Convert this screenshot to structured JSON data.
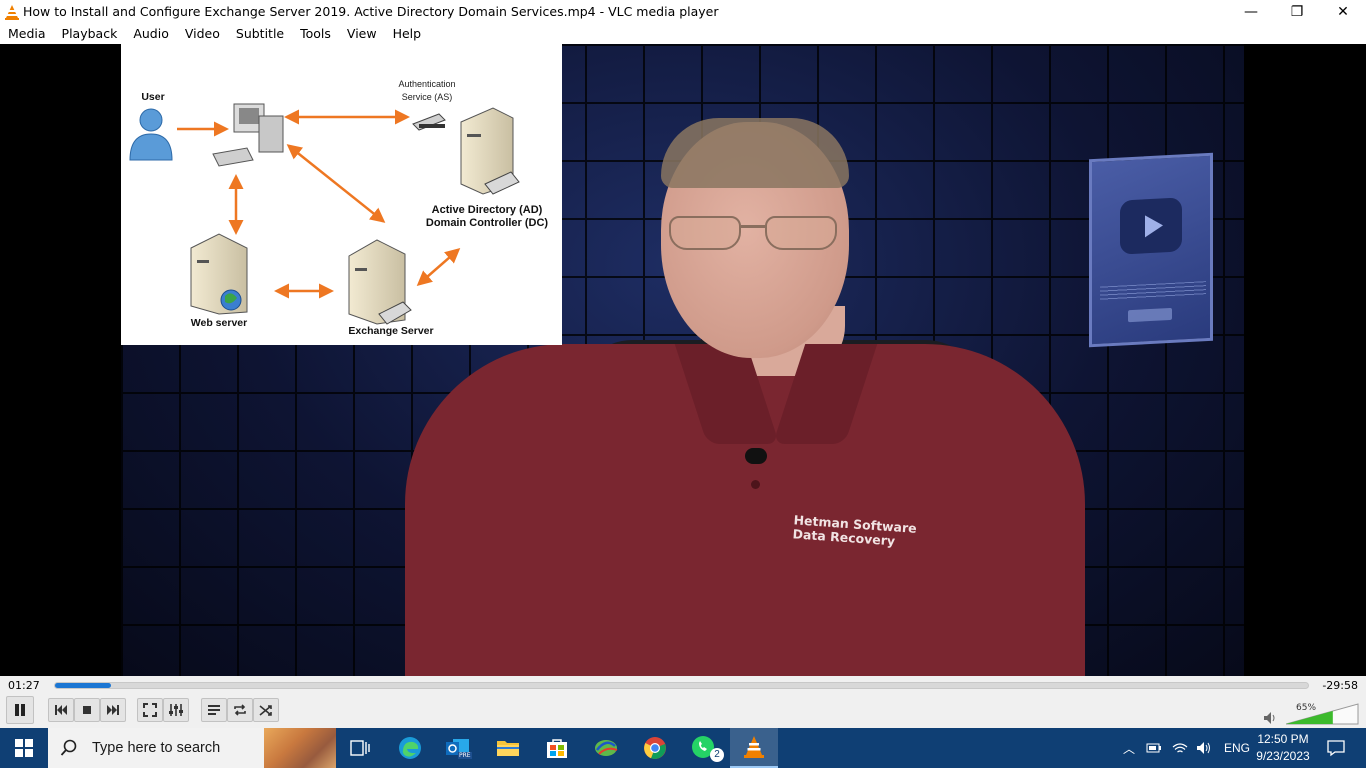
{
  "window": {
    "title": "How to Install and Configure Exchange Server 2019. Active Directory Domain Services.mp4 - VLC media player",
    "minimize": "—",
    "maximize": "❐",
    "close": "✕"
  },
  "menu": [
    "Media",
    "Playback",
    "Audio",
    "Video",
    "Subtitle",
    "Tools",
    "View",
    "Help"
  ],
  "diagram": {
    "user": "User",
    "auth_1": "Authentication",
    "auth_2": "Service (AS)",
    "ad_1": "Active Directory (AD)",
    "ad_2": "Domain Controller (DC)",
    "web": "Web server",
    "exchange": "Exchange Server"
  },
  "video": {
    "shirt_line1": "Hetman Software",
    "shirt_line2": "Data Recovery"
  },
  "player": {
    "elapsed": "01:27",
    "remaining": "-29:58",
    "progress_fraction": 0.045,
    "volume_label": "65%",
    "volume_fraction": 0.65,
    "accent_color": "#1b76d3"
  },
  "taskbar": {
    "search_placeholder": "Type here to search",
    "whatsapp_badge": "2",
    "outlook_badge": "PRE",
    "language": "ENG",
    "time": "12:50 PM",
    "date": "9/23/2023"
  }
}
